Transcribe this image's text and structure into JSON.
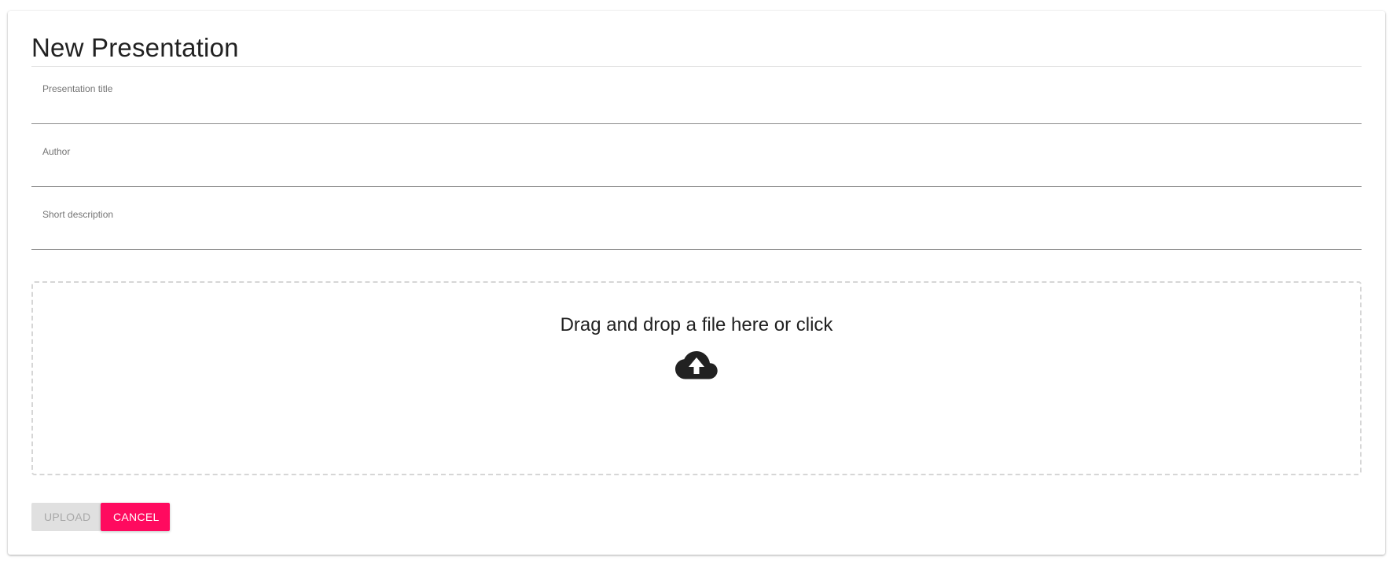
{
  "dialog": {
    "title": "New Presentation"
  },
  "form": {
    "fields": [
      {
        "label": "Presentation title",
        "value": ""
      },
      {
        "label": "Author",
        "value": ""
      },
      {
        "label": "Short description",
        "value": ""
      }
    ]
  },
  "dropzone": {
    "text": "Drag and drop a file here or click",
    "icon": "cloud-upload-icon"
  },
  "actions": {
    "upload_label": "UPLOAD",
    "upload_enabled": false,
    "cancel_label": "CANCEL"
  },
  "colors": {
    "accent": "#ff0a5f",
    "disabled_bg": "#e0e0e0",
    "disabled_text": "#a8a8a8",
    "text": "#212121"
  }
}
